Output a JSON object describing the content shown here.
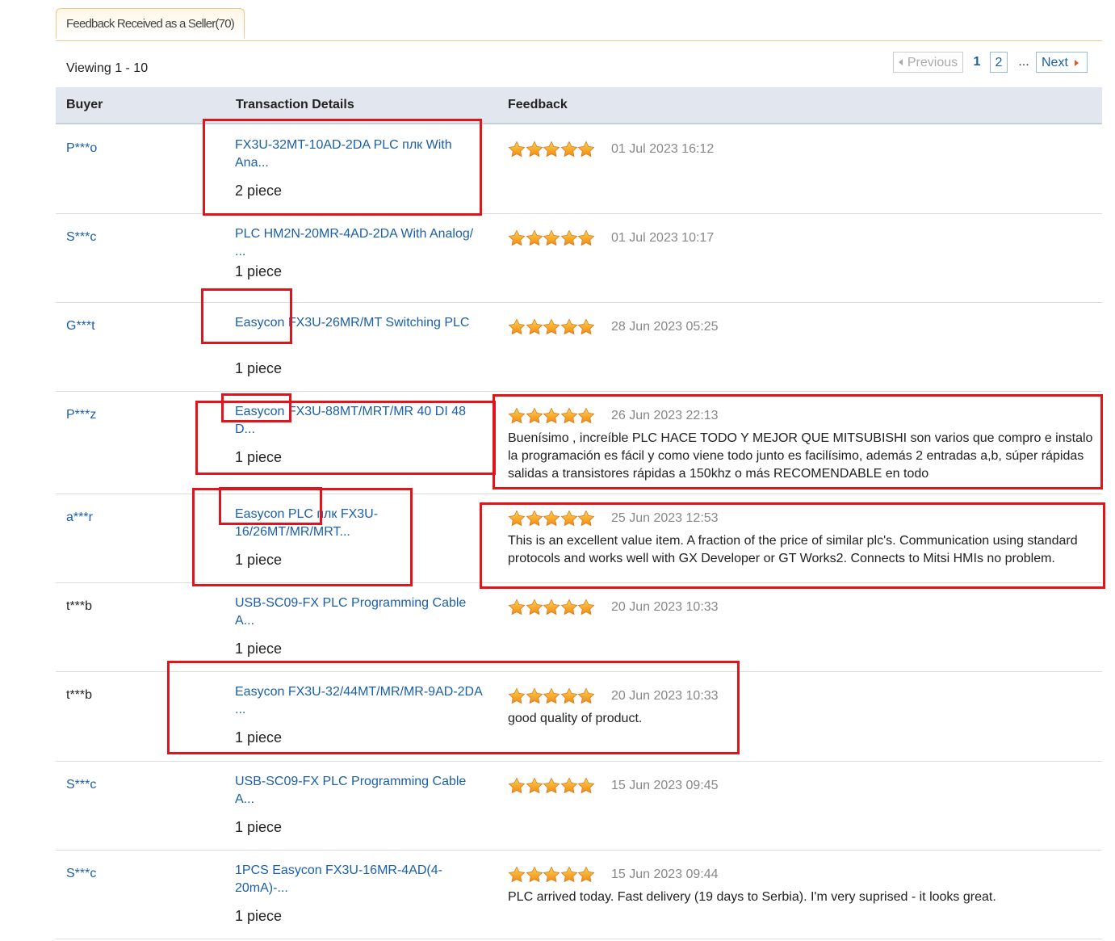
{
  "tab": {
    "label": "Feedback Received as a Seller(70)"
  },
  "viewing": "Viewing 1 - 10",
  "pagination": {
    "previous": "Previous",
    "page1": "1",
    "page2": "2",
    "ellipsis": "...",
    "next": "Next"
  },
  "table": {
    "headers": {
      "buyer": "Buyer",
      "transaction": "Transaction Details",
      "feedback": "Feedback"
    },
    "rows": [
      {
        "buyer": "P***o",
        "product": "FX3U-32MT-10AD-2DA PLC плк With Ana...",
        "quantity": "2 piece",
        "rating": 5,
        "date": "01 Jul 2023 16:12",
        "comment": ""
      },
      {
        "buyer": "S***c",
        "product": "PLC HM2N-20MR-4AD-2DA With Analog/ ...",
        "quantity": "1 piece",
        "rating": 5,
        "date": "01 Jul 2023 10:17",
        "comment": ""
      },
      {
        "buyer": "G***t",
        "product": "Easycon FX3U-26MR/MT Switching PLC",
        "quantity": "1 piece",
        "rating": 5,
        "date": "28 Jun 2023 05:25",
        "comment": ""
      },
      {
        "buyer": "P***z",
        "product": "Easycon FX3U-88MT/MRT/MR 40 DI 48 D...",
        "quantity": "1 piece",
        "rating": 5,
        "date": "26 Jun 2023 22:13",
        "comment": "Buenísimo , increíble PLC HACE TODO Y MEJOR QUE MITSUBISHI son varios que compro e instalo la programación es fácil y como viene todo junto es facilísimo, además 2 entradas a,b, súper rápidas salidas a transistores rápidas a 150khz o más RECOMENDABLE en todo"
      },
      {
        "buyer": "a***r",
        "product": "Easycon PLC плк FX3U-16/26MT/MR/MRT...",
        "quantity": "1 piece",
        "rating": 5,
        "date": "25 Jun 2023 12:53",
        "comment": "This is an excellent value item. A fraction of the price of similar plc's. Communication using standard protocols and works well with GX Developer or GT Works2. Connects to Mitsi HMIs no problem."
      },
      {
        "buyer": "t***b",
        "product": "USB-SC09-FX PLC Programming Cable A...",
        "quantity": "1 piece",
        "rating": 5,
        "date": "20 Jun 2023 10:33",
        "comment": ""
      },
      {
        "buyer": "t***b",
        "product": "Easycon FX3U-32/44MT/MR/MR-9AD-2DA ...",
        "quantity": "1 piece",
        "rating": 5,
        "date": "20 Jun 2023 10:33",
        "comment": "good quality of product."
      },
      {
        "buyer": "S***c",
        "product": "USB-SC09-FX PLC Programming Cable A...",
        "quantity": "1 piece",
        "rating": 5,
        "date": "15 Jun 2023 09:45",
        "comment": ""
      },
      {
        "buyer": "S***c",
        "product": "1PCS Easycon FX3U-16MR-4AD(4-20mA)-...",
        "quantity": "1 piece",
        "rating": 5,
        "date": "15 Jun 2023 09:44",
        "comment": "PLC arrived today. Fast delivery (19 days to Serbia). I'm very suprised - it looks great."
      }
    ]
  },
  "colors": {
    "link": "#1a5fa8",
    "annotation": "#e0141b",
    "star": "#f39c12",
    "header_bg": "#e2e7ef",
    "tab_border": "#f0c68a"
  },
  "icons": {
    "rating": "star-icon",
    "previous": "triangle-left-icon",
    "next": "triangle-right-icon"
  }
}
